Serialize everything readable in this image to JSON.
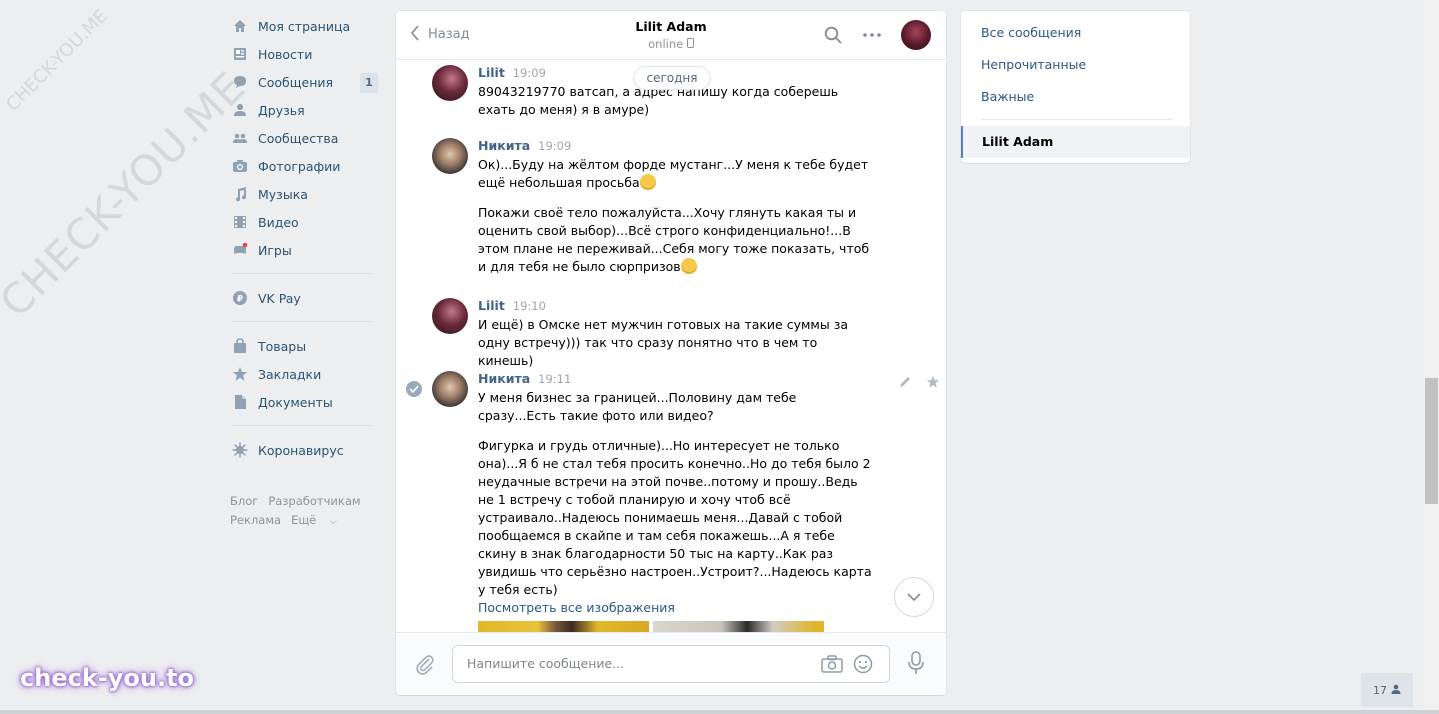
{
  "watermark": {
    "diagonal_large": "CHECK-YOU.ME",
    "diagonal_small": "CHECK-YOU.ME",
    "bottom": "check-you.to"
  },
  "nav": {
    "items": [
      {
        "label": "Моя страница",
        "icon": "home-icon"
      },
      {
        "label": "Новости",
        "icon": "news-icon"
      },
      {
        "label": "Сообщения",
        "icon": "messages-icon",
        "count": "1"
      },
      {
        "label": "Друзья",
        "icon": "friends-icon"
      },
      {
        "label": "Сообщества",
        "icon": "groups-icon"
      },
      {
        "label": "Фотографии",
        "icon": "camera-icon"
      },
      {
        "label": "Музыка",
        "icon": "music-icon"
      },
      {
        "label": "Видео",
        "icon": "video-icon"
      },
      {
        "label": "Игры",
        "icon": "games-icon"
      }
    ],
    "vkpay": "VK Pay",
    "items2": [
      {
        "label": "Товары",
        "icon": "bag-icon"
      },
      {
        "label": "Закладки",
        "icon": "star-icon"
      },
      {
        "label": "Документы",
        "icon": "document-icon"
      }
    ],
    "corona": "Коронавирус",
    "footer": {
      "blog": "Блог",
      "dev": "Разработчикам",
      "ads": "Реклама",
      "more": "Ещё"
    }
  },
  "chat": {
    "back_label": "Назад",
    "peer_name": "Lilit Adam",
    "peer_status": "online",
    "day_label": "сегодня",
    "messages": [
      {
        "author": "Lilit",
        "time": "19:09",
        "texts": [
          "89043219770 ватсап, а адрес напишу когда соберешь ехать до меня) я в амуре)"
        ]
      },
      {
        "author": "Никита",
        "time": "19:09",
        "texts": [
          "Ок)...Буду на жёлтом форде мустанг...У меня к тебе будет ещё небольшая просьба",
          "Покажи своё тело пожалуйста...Хочу глянуть какая ты и оценить свой выбор)...Всё строго конфиденциально!...В этом плане не переживай...Себя могу тоже показать, чтоб и для тебя не было сюрпризов"
        ]
      },
      {
        "author": "Lilit",
        "time": "19:10",
        "texts": [
          "И ещё) в Омске нет мужчин готовых на такие суммы за одну встречу))) так что сразу понятно что в чем то кинешь)"
        ]
      },
      {
        "author": "Никита",
        "time": "19:11",
        "texts": [
          "У меня бизнес за границей...Половину дам тебе сразу...Есть такие фото или видео?",
          "Фигурка и грудь отличные)...Но интересует не только она)...Я б не стал тебя просить конечно..Но до тебя было 2 неудачные встречи на этой почве..потому и прошу..Ведь не 1 встречу с тобой планирую и хочу чтоб всё устраивало..Надеюсь понимаешь меня...Давай с тобой пообщаемся в скайпе и там себя покажешь...А я тебе скину в знак благодарности 50 тыс на карту..Как раз увидишь что серьёзно настроен..Устроит?...Надеюсь карта у тебя есть)"
        ],
        "link": "Посмотреть все изображения"
      }
    ],
    "composer_placeholder": "Напишите сообщение..."
  },
  "right_panel": {
    "all": "Все сообщения",
    "unread": "Непрочитанные",
    "important": "Важные",
    "active": "Lilit Adam"
  },
  "bottom_badge": "17",
  "colors": {
    "link": "#2a5885",
    "nav_text": "#285473",
    "author": "#42648b",
    "bg": "#edeef0"
  }
}
